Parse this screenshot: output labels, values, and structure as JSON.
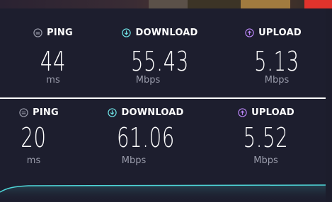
{
  "results": [
    {
      "ping": {
        "label": "PING",
        "value": "44",
        "unit": "ms"
      },
      "download": {
        "label": "DOWNLOAD",
        "value": "55.43",
        "unit": "Mbps"
      },
      "upload": {
        "label": "UPLOAD",
        "value": "5.13",
        "unit": "Mbps"
      }
    },
    {
      "ping": {
        "label": "PING",
        "value": "20",
        "unit": "ms"
      },
      "download": {
        "label": "DOWNLOAD",
        "value": "61.06",
        "unit": "Mbps"
      },
      "upload": {
        "label": "UPLOAD",
        "value": "5.52",
        "unit": "Mbps"
      }
    }
  ],
  "colors": {
    "ping_icon": "#9a9cab",
    "download_icon": "#6fe3e6",
    "upload_icon": "#b884f5",
    "graph_line": "#4fd6d8"
  },
  "icons": {
    "ping": "gauge-icon",
    "download": "arrow-down-circle-icon",
    "upload": "arrow-up-circle-icon"
  }
}
